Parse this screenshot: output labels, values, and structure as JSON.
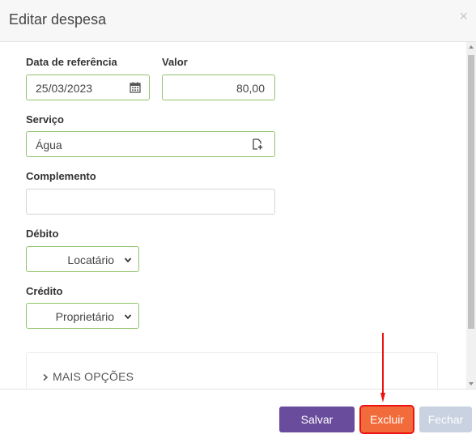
{
  "modal": {
    "title": "Editar despesa",
    "close_symbol": "×"
  },
  "form": {
    "reference_date": {
      "label": "Data de referência",
      "value": "25/03/2023",
      "icon": "calendar-icon"
    },
    "amount": {
      "label": "Valor",
      "value": "80,00"
    },
    "service": {
      "label": "Serviço",
      "value": "Água",
      "icon": "add-document-icon"
    },
    "complement": {
      "label": "Complemento",
      "value": ""
    },
    "debit": {
      "label": "Débito",
      "selected": "Locatário"
    },
    "credit": {
      "label": "Crédito",
      "selected": "Proprietário"
    }
  },
  "more_options": {
    "label": "MAIS OPÇÕES"
  },
  "footer": {
    "save_label": "Salvar",
    "delete_label": "Excluir",
    "close_label": "Fechar"
  },
  "colors": {
    "accent_green_border": "#8fc36a",
    "save_button": "#6a4c9c",
    "delete_button": "#f26b3a",
    "close_button": "#c9d2e1",
    "annotation_red": "#ee1111"
  }
}
